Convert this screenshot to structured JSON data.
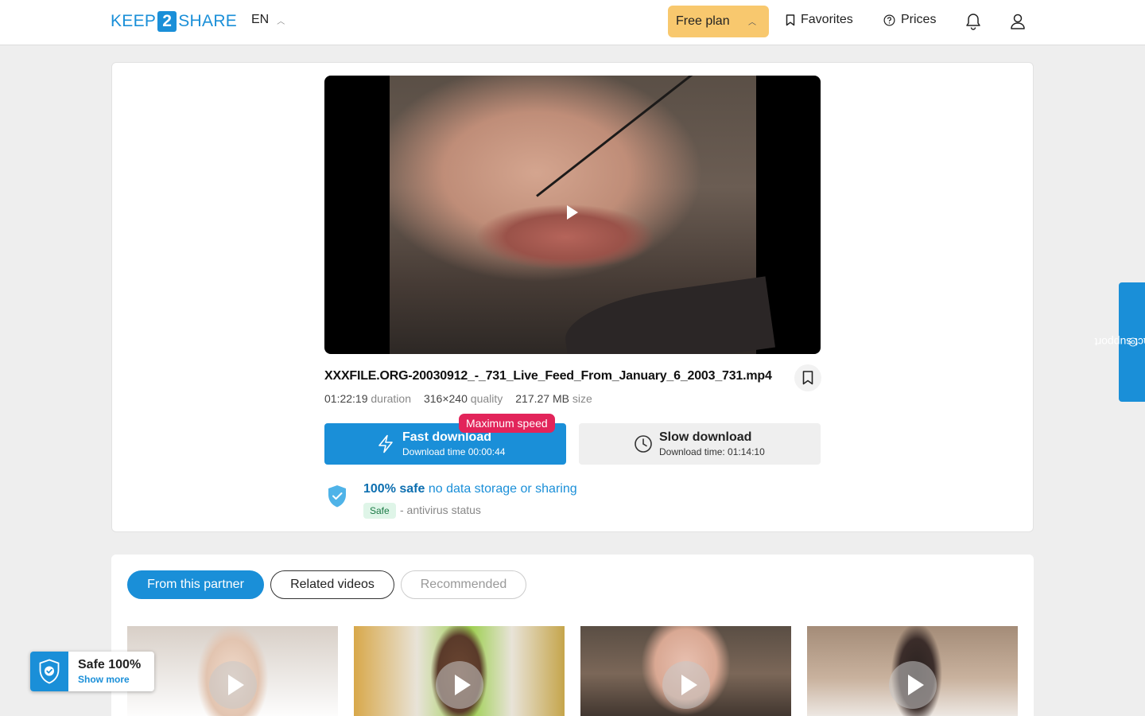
{
  "header": {
    "logo_left": "KEEP",
    "logo_mid": "2",
    "logo_right": "SHARE",
    "language": "EN",
    "plan_label": "Free plan",
    "favorites_label": "Favorites",
    "prices_label": "Prices"
  },
  "file": {
    "name": "XXXFILE.ORG-20030912_-_731_Live_Feed_From_January_6_2003_731.mp4",
    "duration": "01:22:19",
    "duration_label": "duration",
    "quality": "316×240",
    "quality_label": "quality",
    "size": "217.27 MB",
    "size_label": "size"
  },
  "download": {
    "fast_label": "Fast download",
    "fast_time": "Download time 00:00:44",
    "max_badge": "Maximum speed",
    "slow_label": "Slow download",
    "slow_time": "Download time: 01:14:10"
  },
  "safety": {
    "bold": "100% safe",
    "text": "no data storage or sharing",
    "tag": "Safe",
    "status": "- antivirus status"
  },
  "tabs": [
    {
      "label": "From this partner",
      "state": "active"
    },
    {
      "label": "Related videos",
      "state": "outline"
    },
    {
      "label": "Recommended",
      "state": "muted"
    }
  ],
  "widget": {
    "title": "Safe 100%",
    "link": "Show more"
  },
  "contact_label": "contact support",
  "colors": {
    "accent": "#1a8fd8",
    "plan": "#f8c86e",
    "badge": "#e2245a",
    "safe_tag_bg": "#dff5e8"
  }
}
